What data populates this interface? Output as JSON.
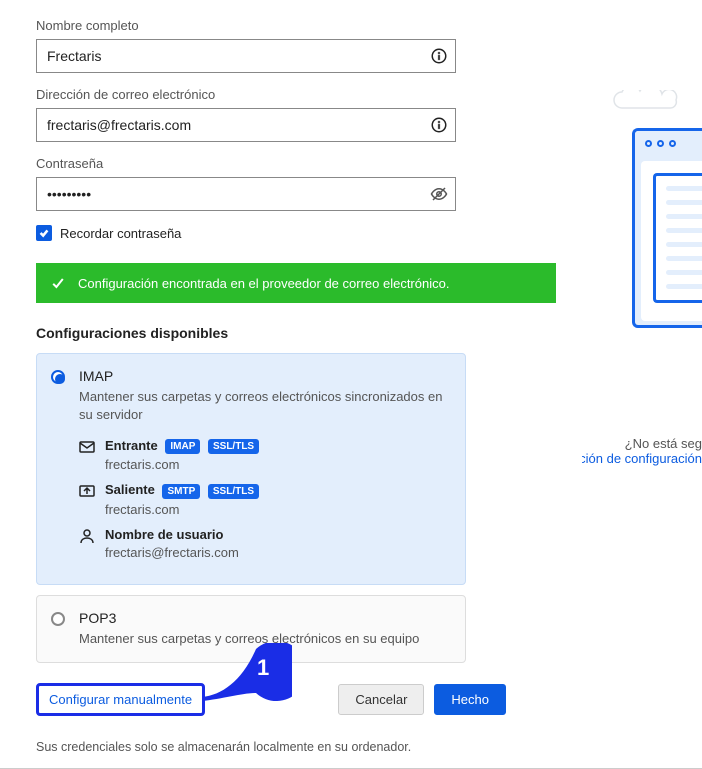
{
  "fields": {
    "fullname_label": "Nombre completo",
    "fullname_value": "Frectaris",
    "email_label": "Dirección de correo electrónico",
    "email_value": "frectaris@frectaris.com",
    "password_label": "Contraseña",
    "password_value": "•••••••••",
    "remember_label": "Recordar contraseña"
  },
  "banner": {
    "text": "Configuración encontrada en el proveedor de correo electrónico."
  },
  "configs_title": "Configuraciones disponibles",
  "imap": {
    "title": "IMAP",
    "desc": "Mantener sus carpetas y correos electrónicos sincronizados en su servidor",
    "incoming_label": "Entrante",
    "incoming_badge1": "IMAP",
    "incoming_badge2": "SSL/TLS",
    "incoming_host": "frectaris.com",
    "outgoing_label": "Saliente",
    "outgoing_badge1": "SMTP",
    "outgoing_badge2": "SSL/TLS",
    "outgoing_host": "frectaris.com",
    "user_label": "Nombre de usuario",
    "user_value": "frectaris@frectaris.com"
  },
  "pop3": {
    "title": "POP3",
    "desc": "Mantener sus carpetas y correos electrónicos en su equipo"
  },
  "actions": {
    "manual": "Configurar manualmente",
    "cancel": "Cancelar",
    "done": "Hecho"
  },
  "callout_number": "1",
  "footer": "Sus credenciales solo se almacenarán localmente en su ordenador.",
  "help": {
    "unsure": "¿No está seg",
    "doc_link": "Documentación de configuración"
  }
}
